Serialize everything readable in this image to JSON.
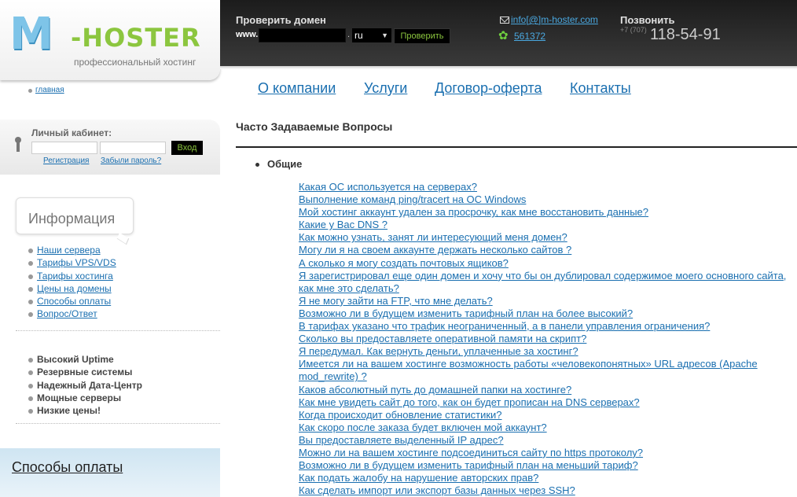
{
  "logo": {
    "m": "M",
    "hoster": "-HOSTER",
    "tagline": "профессиональный хостинг"
  },
  "domain_check": {
    "title": "Проверить домен",
    "prefix": "www.",
    "dot": ".",
    "zone": "ru",
    "button": "Проверить"
  },
  "contacts": {
    "email": "info[@]m-hoster.com",
    "icq": "561372",
    "call_title": "Позвонить",
    "phone_code": "+7 (707)",
    "phone": "118-54-91"
  },
  "home_link": "главная",
  "cabinet": {
    "title": "Личный кабинет:",
    "button": "Вход",
    "register": "Регистрация",
    "forgot": "Забыли пароль?"
  },
  "info": {
    "title": "Информация",
    "links": [
      "Наши сервера",
      "Тарифы VPS/VDS",
      "Тарифы хостинга",
      "Цены на домены",
      "Способы оплаты",
      "Вопрос/Ответ"
    ]
  },
  "features": [
    "Высокий Uptime",
    "Резервные системы",
    "Надежный Дата-Центр",
    "Мощные серверы",
    "Низкие цены!"
  ],
  "payment": {
    "label": "Способы оплаты"
  },
  "nav": [
    "О компании",
    "Услуги",
    "Договор-оферта",
    "Контакты"
  ],
  "faq": {
    "title": "Часто Задаваемые Вопросы",
    "category": "Общие",
    "questions": [
      "Какая ОС используется на серверах?",
      "Выполнение команд ping/tracert на ОС Windows",
      "Мой хостинг аккаунт удален за просрочку, как мне восстановить данные?",
      "Какие у Вас DNS ?",
      "Как можно узнать, занят ли интересующий меня домен?",
      "Могу ли я на своем аккаунте держать несколько сайтов ?",
      "А сколько я могу создать почтовых ящиков?",
      "Я зарегистрировал еще один домен и хочу что бы он дублировал содержимое моего основного сайта, как мне это сделать?",
      "Я не могу зайти на FTP, что мне делать?",
      "Возможно ли в будущем изменить тарифный план на более высокий?",
      "В тарифах указано что трафик неограниченный, а в панели управления ограничения?",
      "Сколько вы предоставляете оперативной памяти на скрипт?",
      "Я передумал. Как вернуть деньги, уплаченные за хостинг?",
      "Имеется ли на вашем хостинге возможность работы «человекопонятных» URL адресов (Apache mod_rewrite) ?",
      "Каков абсолютный путь до домашней папки на хостинге?",
      "Как мне увидеть сайт до того, как он будет прописан на DNS серверах?",
      "Когда происходит обновление статистики?",
      "Как скоро после заказа будет включен мой аккаунт?",
      "Вы предоставляете выделенный IP адрес?",
      "Можно ли на вашем хостинге подсоединиться сайту по https протоколу?",
      "Возможно ли в будущем изменить тарифный план на меньший тариф?",
      "Как подать жалобу на нарушение авторских прав?",
      "Как сделать импорт или экспорт базы данных через SSH?"
    ]
  }
}
